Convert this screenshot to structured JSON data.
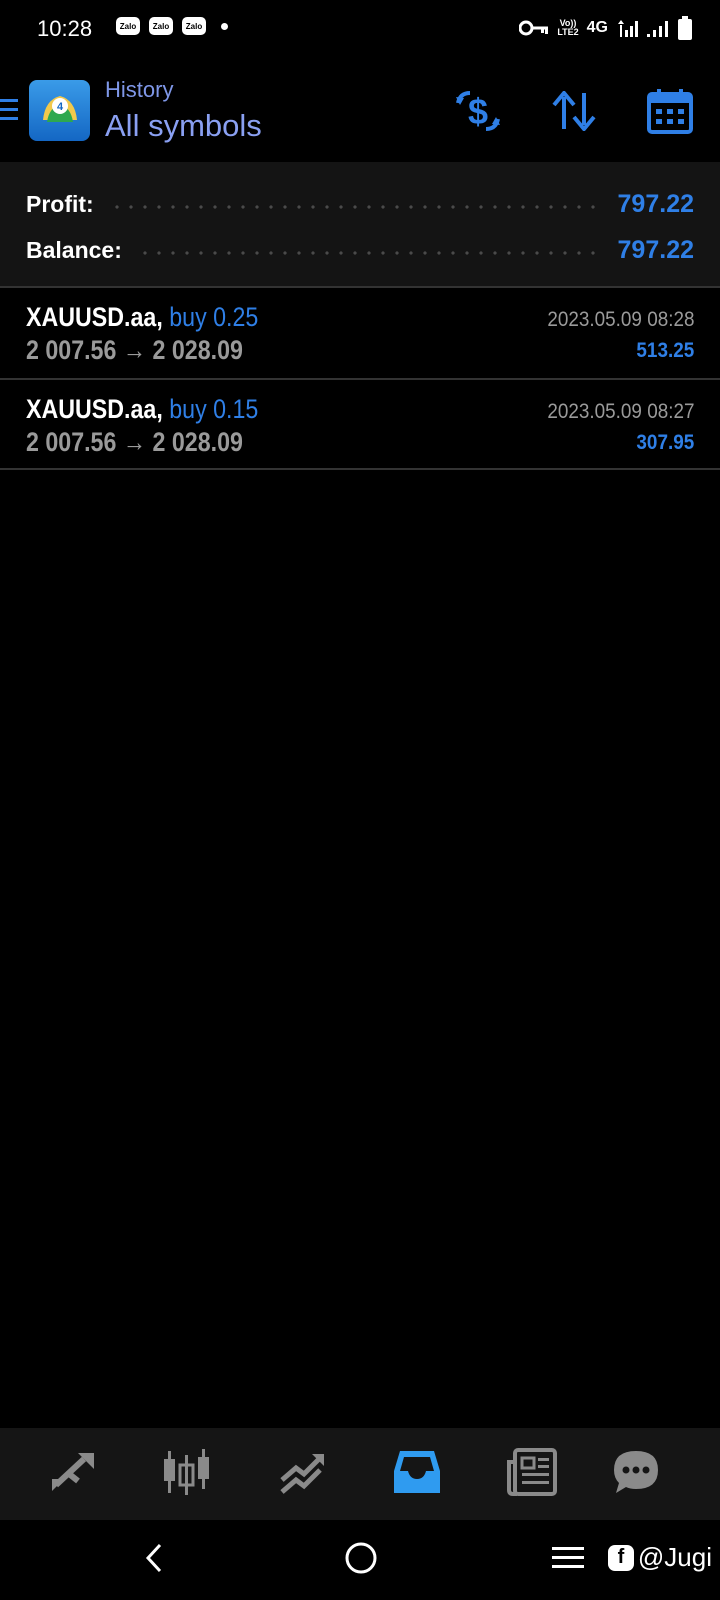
{
  "status_bar": {
    "time": "10:28",
    "notifications": [
      "Zalo",
      "Zalo",
      "Zalo"
    ],
    "volte_line1": "Vo))",
    "volte_line2": "LTE2",
    "network": "4G",
    "icons": [
      "key-icon",
      "signal-icon",
      "signal-icon",
      "battery-icon"
    ]
  },
  "header": {
    "subtitle": "History",
    "title": "All symbols",
    "actions": [
      "currency-exchange-icon",
      "sort-icon",
      "calendar-icon"
    ],
    "accent_color": "#2f7fe6"
  },
  "summary": {
    "profit_label": "Profit:",
    "profit_value": "797.22",
    "balance_label": "Balance:",
    "balance_value": "797.22"
  },
  "deals": [
    {
      "symbol": "XAUUSD.aa,",
      "side": "buy 0.25",
      "prices": "2 007.56 → 2 028.09",
      "time": "2023.05.09 08:28",
      "profit": "513.25"
    },
    {
      "symbol": "XAUUSD.aa,",
      "side": "buy 0.15",
      "prices": "2 007.56 → 2 028.09",
      "time": "2023.05.09 08:27",
      "profit": "307.95"
    }
  ],
  "bottom_nav": {
    "items": [
      "quotes-icon",
      "chart-icon",
      "trade-icon",
      "history-icon",
      "news-icon",
      "chat-icon"
    ],
    "active": "history-icon"
  },
  "system_nav": {
    "watermark": "@Jugi",
    "watermark_badge": "f"
  }
}
